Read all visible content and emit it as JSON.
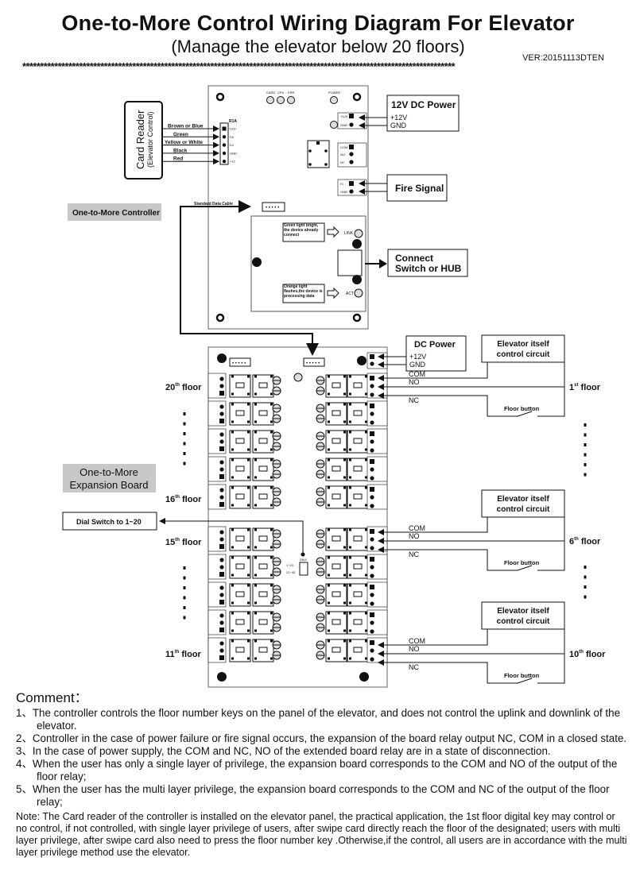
{
  "header": {
    "title": "One-to-More Control Wiring Diagram For Elevator",
    "subtitle": "(Manage the elevator below 20 floors)",
    "version": "VER:20151113DTEN",
    "separator": "**************************************************************************************************************************"
  },
  "card_reader": {
    "title": "Card Reader",
    "subtitle": "(Elevator Control)",
    "wires": [
      "Brown or Blue",
      "Green",
      "Yellow or White",
      "Black",
      "Red"
    ],
    "terminal_header": "R1A",
    "terminals": [
      "LED",
      "D0",
      "D1",
      "GND",
      "+12"
    ]
  },
  "controller": {
    "label": "One-to-More Controller",
    "leds": [
      "CARD",
      "CPU",
      "ERR",
      "POWER"
    ],
    "relay_terminals": [
      "COM",
      "NO",
      "NC"
    ],
    "fire_terminals": [
      "FL",
      "GND"
    ],
    "power_terminals": [
      "+12V",
      "GND"
    ],
    "cable_label": "Standard Data Cable",
    "green_note": "Green light bright, the device already connect",
    "orange_note": "Orange light flashes,the device is processing data",
    "link_led": "LINK",
    "act_led": "ACT"
  },
  "power_box": {
    "title": "12V DC Power",
    "lines": [
      "+12V",
      "GND"
    ]
  },
  "fire_box": {
    "title": "Fire Signal"
  },
  "network_box": {
    "line1": "Connect",
    "line2": "Switch  or HUB"
  },
  "expansion": {
    "label_line1": "One-to-More",
    "label_line2": "Expansion Board",
    "dc_power": {
      "title": "DC  Power",
      "lines": [
        "+12V",
        "GND"
      ]
    },
    "dial_switch": "Dial Switch to 1~20",
    "switch_name": "SW4",
    "switch_options": [
      "1~20",
      "21~40"
    ],
    "left_floors": [
      {
        "num": "20",
        "sup": "th",
        "word": "floor"
      },
      {
        "num": "16",
        "sup": "th",
        "word": "floor"
      },
      {
        "num": "15",
        "sup": "th",
        "word": "floor"
      },
      {
        "num": "11",
        "sup": "th",
        "word": "floor"
      }
    ],
    "right_groups": [
      {
        "circuit_line1": "Elevator itself",
        "circuit_line2": "control circuit",
        "com": "COM",
        "no": "NO",
        "nc": "NC",
        "button": "Floor button",
        "floor": {
          "num": "1",
          "sup": "st",
          "word": "floor"
        }
      },
      {
        "circuit_line1": "Elevator itself",
        "circuit_line2": "control circuit",
        "com": "COM",
        "no": "NO",
        "nc": "NC",
        "button": "Floor button",
        "floor": {
          "num": "6",
          "sup": "th",
          "word": "floor"
        }
      },
      {
        "circuit_line1": "Elevator itself",
        "circuit_line2": "control circuit",
        "com": "COM",
        "no": "NO",
        "nc": "NC",
        "button": "Floor button",
        "floor": {
          "num": "10",
          "sup": "th",
          "word": "floor"
        }
      }
    ]
  },
  "comments": {
    "heading": "Comment：",
    "items": [
      "1、The controller controls the floor number keys on the panel of the elevator, and does not control the uplink and downlink of the elevator.",
      "2、Controller in the case of power failure or fire signal occurs, the expansion of the board relay output NC, COM in a closed state.",
      "3、In the case of power supply, the COM and NC, NO of the extended board relay are in a state of disconnection.",
      "4、When the user has only a single layer of privilege, the expansion board corresponds to the COM and NO of the output of the floor relay;",
      "5、When the user has the multi layer privilege, the expansion board corresponds to the COM and NC of the output of the floor relay;"
    ],
    "note": "Note: The Card reader of the controller is installed on the elevator panel, the practical application, the 1st floor digital key may control or no control, if not controlled, with single layer privilege of users, after swipe card directly reach the floor of the designated; users with multi layer privilege, after swipe card also need to press the floor number key .Otherwise,if the control, all users are in accordance with the multi layer privilege method use the elevator."
  }
}
